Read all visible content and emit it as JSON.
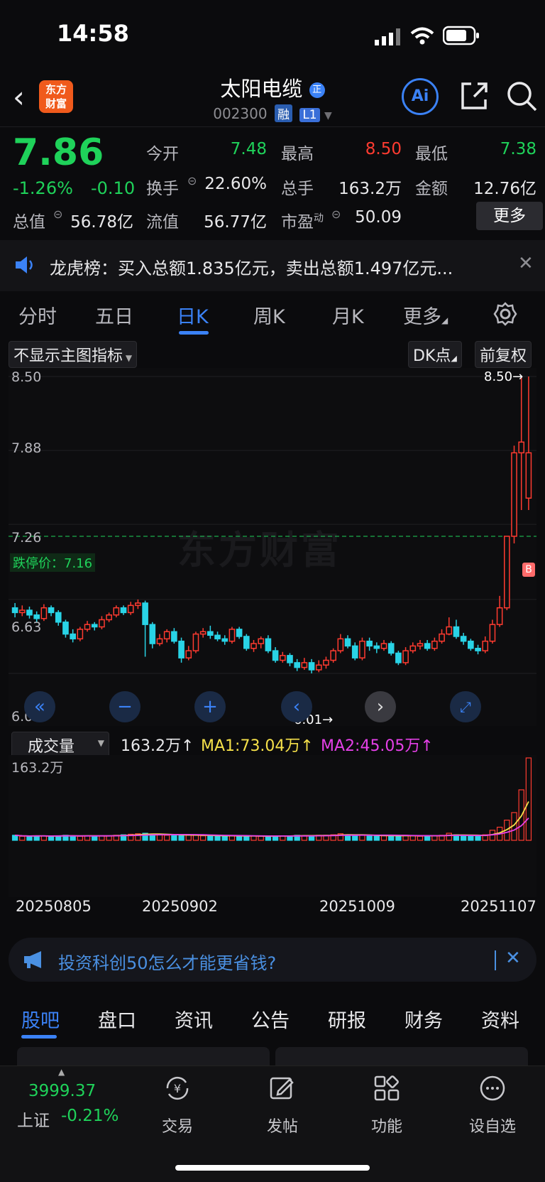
{
  "status": {
    "time": "14:58"
  },
  "header": {
    "logo_text_1": "东方",
    "logo_text_2": "财富",
    "stock_name": "太阳电缆",
    "stock_code": "002300",
    "tag_rong": "融",
    "tag_level": "L1",
    "ai_label": "Ai"
  },
  "quote": {
    "price": "7.86",
    "change_pct": "-1.26%",
    "change_amt": "-0.10",
    "open_label": "今开",
    "open": "7.48",
    "high_label": "最高",
    "high": "8.50",
    "low_label": "最低",
    "low": "7.38",
    "turnover_label": "换手",
    "turnover": "22.60%",
    "volume_label": "总手",
    "volume": "163.2万",
    "amount_label": "金额",
    "amount": "12.76亿",
    "mktcap_label": "总值",
    "mktcap": "56.78亿",
    "float_label": "流值",
    "float": "56.77亿",
    "pe_label": "市盈",
    "pe_sup": "动",
    "pe": "50.09",
    "more_label": "更多"
  },
  "notice": {
    "text": "龙虎榜：买入总额1.835亿元，卖出总额1.497亿元..."
  },
  "chart_tabs": [
    "分时",
    "五日",
    "日K",
    "周K",
    "月K",
    "更多"
  ],
  "chart_tabs_active": 2,
  "chart_toolbar": {
    "indicator": "不显示主图指标",
    "dk": "DK点",
    "adjust": "前复权"
  },
  "price_axis": [
    "8.50",
    "7.88",
    "7.26",
    "6.63",
    "6.01"
  ],
  "limit_down_label": "跌停价：7.16",
  "high_marker": "8.50→",
  "low_marker": "6.01→",
  "watermark": "东方财富",
  "volume_panel": {
    "selector": "成交量",
    "total": "163.2万↑",
    "ma1": "MA1:73.04万↑",
    "ma2": "MA2:45.05万↑",
    "axis_max": "163.2万"
  },
  "dates": [
    "20250805",
    "20250902",
    "20251009",
    "20251107"
  ],
  "chart_data": {
    "type": "candlestick",
    "ylim": [
      6.01,
      8.5
    ],
    "limit_down": 7.16,
    "candles": [
      [
        6.56,
        6.52,
        6.6,
        6.48
      ],
      [
        6.52,
        6.54,
        6.58,
        6.49
      ],
      [
        6.54,
        6.5,
        6.57,
        6.47
      ],
      [
        6.5,
        6.47,
        6.53,
        6.44
      ],
      [
        6.47,
        6.56,
        6.59,
        6.45
      ],
      [
        6.56,
        6.52,
        6.58,
        6.49
      ],
      [
        6.52,
        6.44,
        6.54,
        6.41
      ],
      [
        6.44,
        6.34,
        6.46,
        6.31
      ],
      [
        6.34,
        6.3,
        6.38,
        6.27
      ],
      [
        6.3,
        6.38,
        6.4,
        6.28
      ],
      [
        6.38,
        6.42,
        6.45,
        6.36
      ],
      [
        6.42,
        6.4,
        6.44,
        6.37
      ],
      [
        6.4,
        6.46,
        6.49,
        6.38
      ],
      [
        6.46,
        6.5,
        6.52,
        6.44
      ],
      [
        6.5,
        6.56,
        6.58,
        6.48
      ],
      [
        6.56,
        6.52,
        6.58,
        6.5
      ],
      [
        6.52,
        6.58,
        6.61,
        6.5
      ],
      [
        6.58,
        6.6,
        6.63,
        6.55
      ],
      [
        6.6,
        6.42,
        6.62,
        6.15
      ],
      [
        6.42,
        6.26,
        6.44,
        6.22
      ],
      [
        6.26,
        6.3,
        6.34,
        6.24
      ],
      [
        6.3,
        6.36,
        6.38,
        6.27
      ],
      [
        6.36,
        6.28,
        6.39,
        6.26
      ],
      [
        6.28,
        6.14,
        6.31,
        6.1
      ],
      [
        6.14,
        6.2,
        6.24,
        6.12
      ],
      [
        6.2,
        6.34,
        6.36,
        6.18
      ],
      [
        6.34,
        6.36,
        6.39,
        6.31
      ],
      [
        6.36,
        6.33,
        6.41,
        6.3
      ],
      [
        6.33,
        6.3,
        6.36,
        6.28
      ],
      [
        6.3,
        6.28,
        6.33,
        6.25
      ],
      [
        6.28,
        6.38,
        6.4,
        6.26
      ],
      [
        6.38,
        6.32,
        6.4,
        6.3
      ],
      [
        6.32,
        6.22,
        6.34,
        6.2
      ],
      [
        6.22,
        6.26,
        6.29,
        6.19
      ],
      [
        6.26,
        6.3,
        6.32,
        6.22
      ],
      [
        6.3,
        6.2,
        6.33,
        6.18
      ],
      [
        6.2,
        6.12,
        6.23,
        6.1
      ],
      [
        6.12,
        6.16,
        6.19,
        6.1
      ],
      [
        6.16,
        6.1,
        6.18,
        6.07
      ],
      [
        6.1,
        6.06,
        6.13,
        6.03
      ],
      [
        6.06,
        6.1,
        6.14,
        6.04
      ],
      [
        6.1,
        6.04,
        6.13,
        6.01
      ],
      [
        6.04,
        6.08,
        6.12,
        6.02
      ],
      [
        6.08,
        6.12,
        6.15,
        6.05
      ],
      [
        6.12,
        6.2,
        6.22,
        6.1
      ],
      [
        6.2,
        6.3,
        6.34,
        6.18
      ],
      [
        6.3,
        6.24,
        6.33,
        6.22
      ],
      [
        6.24,
        6.14,
        6.27,
        6.12
      ],
      [
        6.14,
        6.28,
        6.31,
        6.12
      ],
      [
        6.28,
        6.24,
        6.31,
        6.2
      ],
      [
        6.24,
        6.22,
        6.27,
        6.18
      ],
      [
        6.22,
        6.26,
        6.29,
        6.2
      ],
      [
        6.26,
        6.18,
        6.28,
        6.16
      ],
      [
        6.18,
        6.1,
        6.2,
        6.08
      ],
      [
        6.1,
        6.2,
        6.23,
        6.08
      ],
      [
        6.2,
        6.24,
        6.27,
        6.18
      ],
      [
        6.24,
        6.26,
        6.29,
        6.21
      ],
      [
        6.26,
        6.22,
        6.29,
        6.2
      ],
      [
        6.22,
        6.28,
        6.31,
        6.2
      ],
      [
        6.28,
        6.34,
        6.38,
        6.26
      ],
      [
        6.34,
        6.4,
        6.48,
        6.33
      ],
      [
        6.4,
        6.32,
        6.46,
        6.3
      ],
      [
        6.32,
        6.28,
        6.35,
        6.25
      ],
      [
        6.28,
        6.22,
        6.3,
        6.2
      ],
      [
        6.22,
        6.2,
        6.25,
        6.17
      ],
      [
        6.2,
        6.28,
        6.32,
        6.18
      ],
      [
        6.28,
        6.42,
        6.46,
        6.26
      ],
      [
        6.42,
        6.56,
        6.66,
        6.4
      ],
      [
        6.56,
        7.16,
        7.16,
        6.54
      ],
      [
        7.16,
        7.86,
        7.92,
        7.1
      ],
      [
        7.86,
        7.95,
        8.5,
        7.38
      ],
      [
        7.48,
        7.86,
        8.5,
        7.38
      ]
    ],
    "volume_max": 163.2,
    "volumes": [
      10,
      8,
      8,
      9,
      9,
      8,
      9,
      10,
      9,
      8,
      9,
      9,
      9,
      9,
      10,
      11,
      12,
      13,
      14,
      12,
      11,
      10,
      10,
      11,
      10,
      10,
      9,
      9,
      9,
      9,
      9,
      8,
      8,
      9,
      8,
      8,
      9,
      9,
      9,
      10,
      9,
      9,
      10,
      10,
      11,
      13,
      11,
      9,
      10,
      10,
      9,
      9,
      9,
      9,
      10,
      9,
      8,
      9,
      9,
      10,
      14,
      11,
      9,
      8,
      9,
      11,
      20,
      26,
      40,
      55,
      100,
      163.2
    ]
  },
  "ad": {
    "text": "投资科创50怎么才能更省钱?"
  },
  "sub_tabs": [
    "股吧",
    "盘口",
    "资讯",
    "公告",
    "研报",
    "财务",
    "资料"
  ],
  "sub_tabs_active": 0,
  "bottom_nav": {
    "index_value": "3999.37",
    "index_name": "上证",
    "index_change": "-0.21%",
    "trade": "交易",
    "post": "发帖",
    "func": "功能",
    "watch": "设自选"
  },
  "colors": {
    "up": "#ff3b30",
    "down": "#1fd25a",
    "accent": "#3b82f6",
    "candle_down": "#29d3e6"
  }
}
